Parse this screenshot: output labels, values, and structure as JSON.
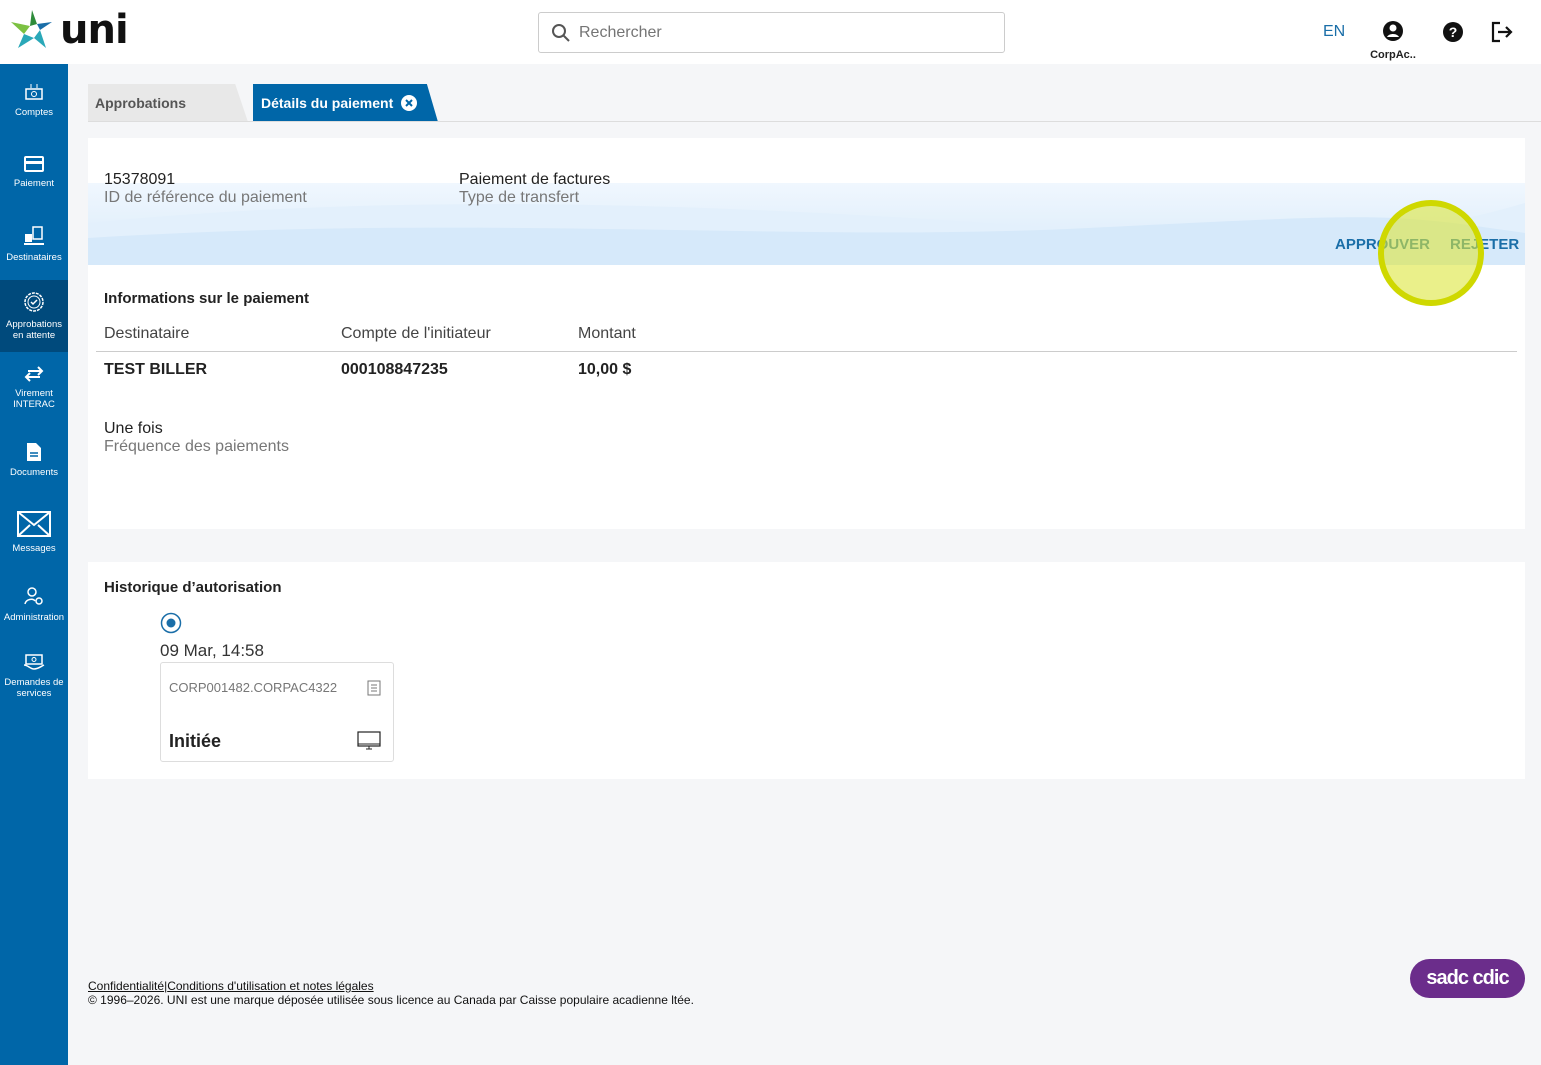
{
  "header": {
    "logo": "uni",
    "search_placeholder": "Rechercher",
    "lang": "EN",
    "user": "CorpAc.."
  },
  "sidebar": {
    "items": [
      {
        "label": "Comptes"
      },
      {
        "label": "Paiement"
      },
      {
        "label": "Destinataires"
      },
      {
        "label": "Approbations en attente"
      },
      {
        "label": "Virement INTERAC"
      },
      {
        "label": "Documents"
      },
      {
        "label": "Messages"
      },
      {
        "label": "Administration"
      },
      {
        "label": "Demandes de services"
      }
    ]
  },
  "tabs": [
    {
      "label": "Approbations"
    },
    {
      "label": "Détails du paiement"
    }
  ],
  "summary": {
    "ref_value": "15378091",
    "ref_label": "ID de référence du paiement",
    "type_value": "Paiement de factures",
    "type_label": "Type de transfert",
    "approve": "APPROUVER",
    "reject": "REJETER"
  },
  "info": {
    "title": "Informations sur le paiement",
    "columns": [
      "Destinataire",
      "Compte de l'initiateur",
      "Montant"
    ],
    "row": [
      "TEST BILLER",
      "000108847235",
      "10,00 $"
    ],
    "freq_value": "Une fois",
    "freq_label": "Fréquence des paiements"
  },
  "history": {
    "title": "Historique d’autorisation",
    "date": "09 Mar, 14:58",
    "user": "CORP001482.CORPAC4322",
    "status": "Initiée"
  },
  "footer": {
    "privacy": "Confidentialité",
    "sep": "|",
    "terms": "Conditions d'utilisation et notes légales",
    "copyright": "© 1996–2026. UNI est une marque déposée utilisée sous licence au Canada par Caisse populaire acadienne ltée.",
    "cdic": "sadc cdic"
  }
}
